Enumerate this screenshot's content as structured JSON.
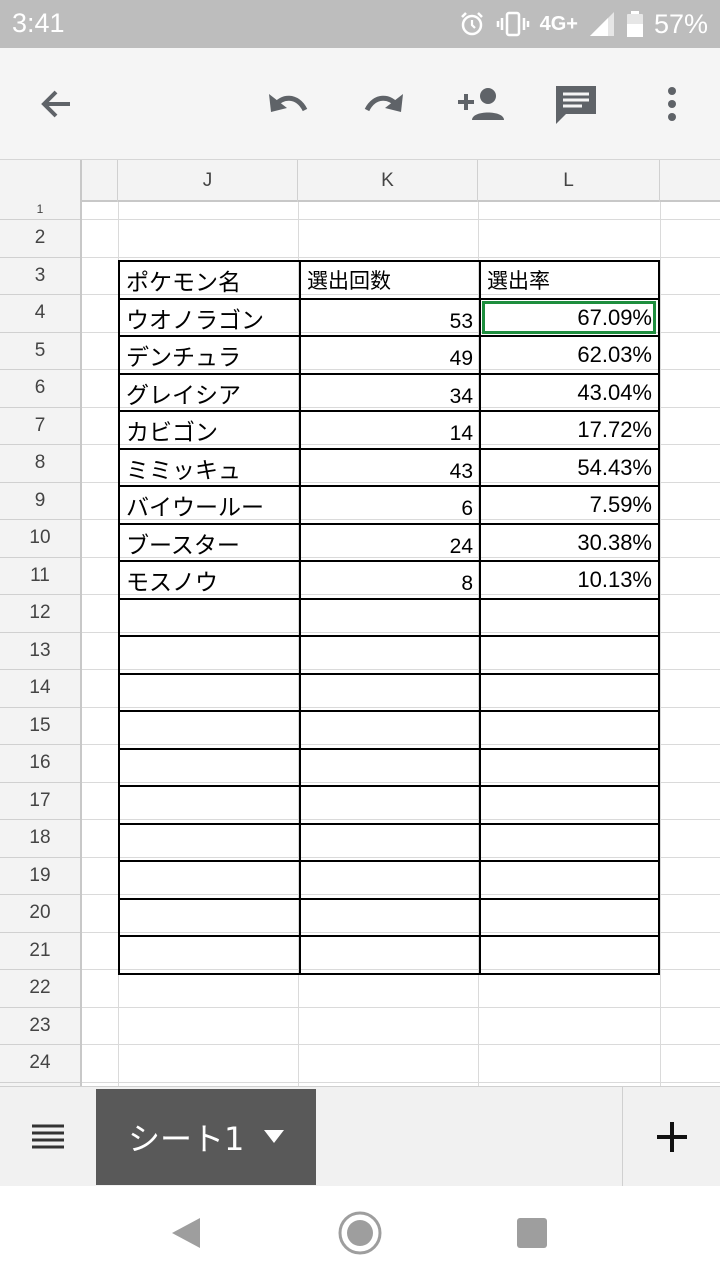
{
  "status_bar": {
    "time": "3:41",
    "network": "4G+",
    "battery": "57%",
    "icons": [
      "alarm-icon",
      "vibrate-icon",
      "signal-icon",
      "battery-icon"
    ]
  },
  "toolbar": {
    "icons": [
      "back-arrow-icon",
      "undo-icon",
      "redo-icon",
      "add-person-icon",
      "comment-icon",
      "more-vert-icon"
    ]
  },
  "grid": {
    "columns": [
      "J",
      "K",
      "L"
    ],
    "rows": [
      "1",
      "2",
      "3",
      "4",
      "5",
      "6",
      "7",
      "8",
      "9",
      "10",
      "11",
      "12",
      "13",
      "14",
      "15",
      "16",
      "17",
      "18",
      "19",
      "20",
      "21",
      "22",
      "23",
      "24"
    ]
  },
  "table": {
    "headers": [
      "ポケモン名",
      "選出回数",
      "選出率"
    ],
    "rows": [
      [
        "ウオノラゴン",
        "53",
        "67.09%"
      ],
      [
        "デンチュラ",
        "49",
        "62.03%"
      ],
      [
        "グレイシア",
        "34",
        "43.04%"
      ],
      [
        "カビゴン",
        "14",
        "17.72%"
      ],
      [
        "ミミッキュ",
        "43",
        "54.43%"
      ],
      [
        "バイウールー",
        "6",
        "7.59%"
      ],
      [
        "ブースター",
        "24",
        "30.38%"
      ],
      [
        "モスノウ",
        "8",
        "10.13%"
      ]
    ],
    "selected_cell": "L4"
  },
  "sheet_bar": {
    "active_sheet": "シート1",
    "icons": [
      "sheet-list-icon",
      "dropdown-icon",
      "add-sheet-icon"
    ]
  },
  "colors": {
    "status_bar": "#bdbdbd",
    "toolbar": "#f5f5f5",
    "selection": "#1e8e3e",
    "active_tab": "#595959"
  }
}
